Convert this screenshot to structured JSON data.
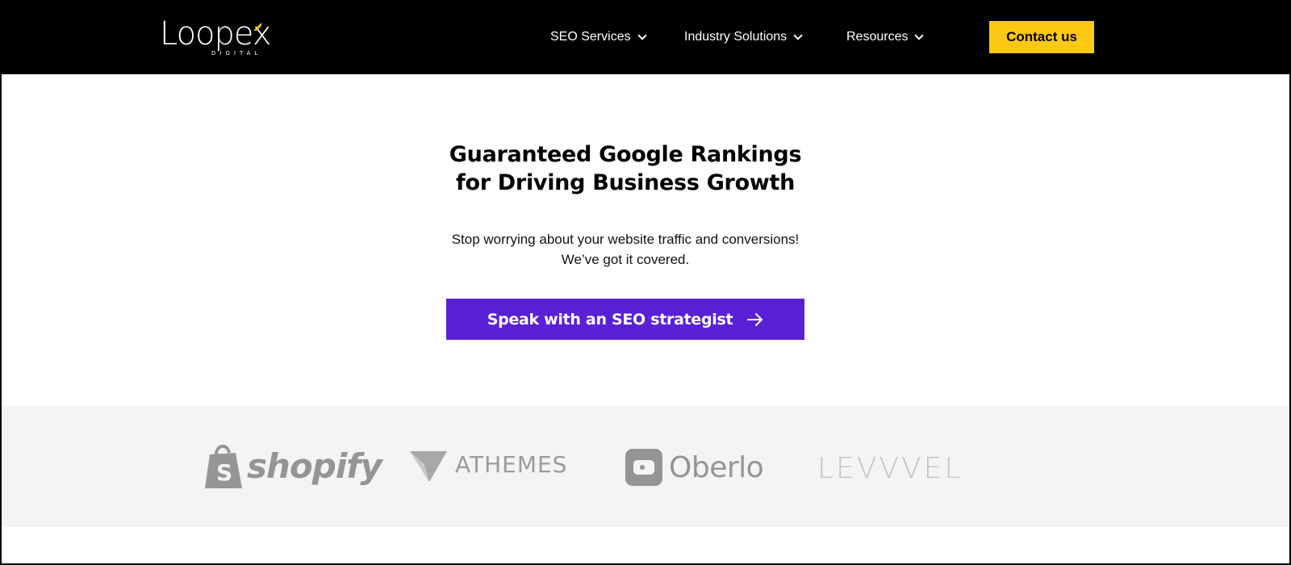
{
  "header": {
    "logo_text": "Loopex",
    "logo_subtext": "DIGITAL",
    "nav": [
      {
        "label": "SEO Services"
      },
      {
        "label": "Industry Solutions"
      },
      {
        "label": "Resources"
      }
    ],
    "contact_label": "Contact us"
  },
  "hero": {
    "title_line1": "Guaranteed Google Rankings",
    "title_line2": "for Driving Business Growth",
    "subtitle_line1": "Stop worrying about your website traffic and conversions!",
    "subtitle_line2": "We’ve got it covered.",
    "cta_label": "Speak with an SEO strategist"
  },
  "brands": [
    {
      "name": "shopify",
      "icon": "shopify-bag-icon"
    },
    {
      "name": "ATHEMES",
      "icon": "athemes-plane-icon"
    },
    {
      "name": "Oberlo",
      "icon": "oberlo-icon"
    },
    {
      "name": "LEVVVEL"
    }
  ],
  "colors": {
    "header_bg": "#000000",
    "contact_button": "#fbc814",
    "cta_button": "#5a20d6",
    "logos_band_bg": "#f4f4f4",
    "logo_accent": "#fbc814"
  }
}
